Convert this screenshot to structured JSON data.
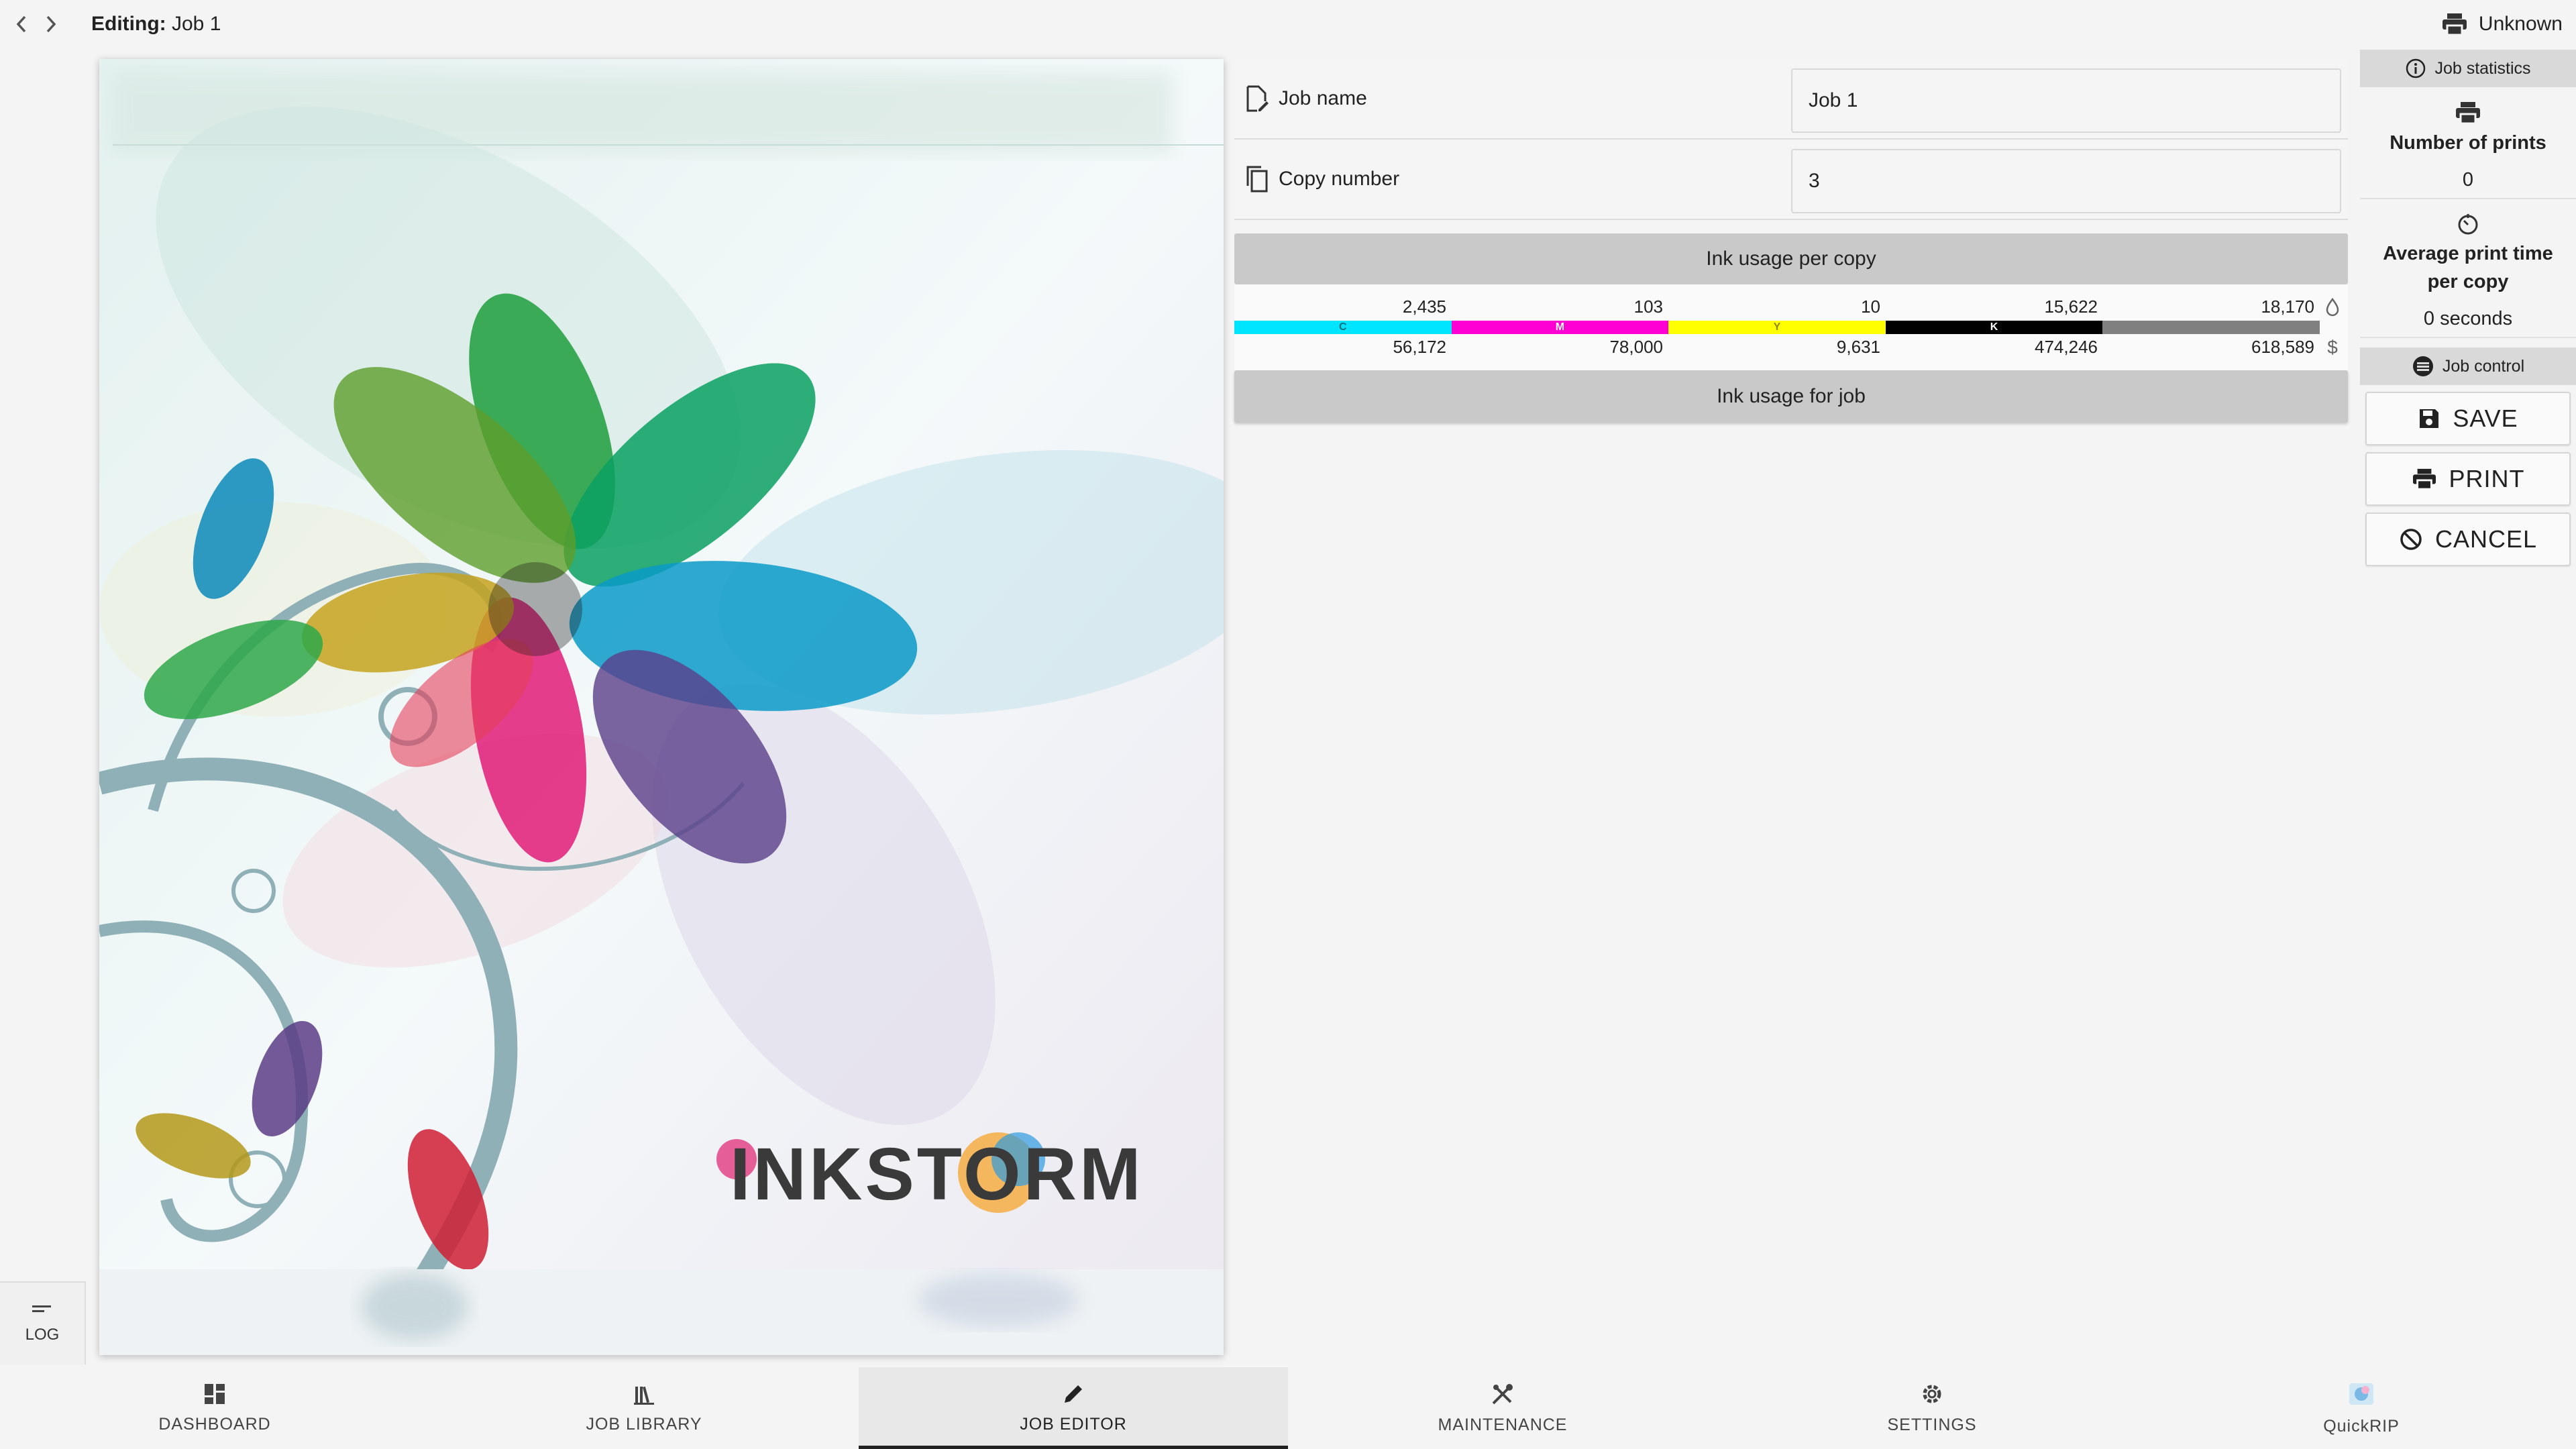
{
  "topbar": {
    "back_icon": "chevron-left-icon",
    "forward_icon": "chevron-right-icon",
    "editing_prefix": "Editing:",
    "job_title": "Job 1",
    "printer_status": "Unknown"
  },
  "log": {
    "label": "LOG"
  },
  "preview": {
    "logo_text": "INKSTORM"
  },
  "form": {
    "job_name_label": "Job name",
    "job_name_value": "Job 1",
    "copy_number_label": "Copy number",
    "copy_number_value": "3"
  },
  "ink": {
    "header": "Ink usage per copy",
    "footer": "Ink usage for job",
    "columns": [
      {
        "letter": "C",
        "color": "#00e5ff",
        "usage": "2,435",
        "cost": "56,172"
      },
      {
        "letter": "M",
        "color": "#ff00d4",
        "usage": "103",
        "cost": "78,000"
      },
      {
        "letter": "Y",
        "color": "#ffff00",
        "usage": "10",
        "cost": "9,631"
      },
      {
        "letter": "K",
        "color": "#000000",
        "usage": "15,622",
        "cost": "474,246"
      },
      {
        "letter": "",
        "color": "#808080",
        "usage": "18,170",
        "cost": "618,589"
      }
    ],
    "usage_icon": "drop-icon",
    "cost_icon": "dollar-icon"
  },
  "sidebar": {
    "stats_header": "Job statistics",
    "prints_title": "Number of prints",
    "prints_value": "0",
    "avg_title": "Average print time per copy",
    "avg_value": "0 seconds",
    "control_header": "Job control",
    "save_label": "SAVE",
    "print_label": "PRINT",
    "cancel_label": "CANCEL"
  },
  "nav": {
    "tabs": [
      {
        "label": "DASHBOARD",
        "icon": "dashboard-icon"
      },
      {
        "label": "JOB LIBRARY",
        "icon": "library-icon"
      },
      {
        "label": "JOB EDITOR",
        "icon": "pencil-icon"
      },
      {
        "label": "MAINTENANCE",
        "icon": "tools-icon"
      },
      {
        "label": "SETTINGS",
        "icon": "gear-icon"
      },
      {
        "label": "QuickRIP",
        "icon": "quickrip-icon"
      }
    ],
    "active": "JOB EDITOR"
  },
  "colors": {
    "cyan": "#00e5ff",
    "magenta": "#ff00d4",
    "yellow": "#ffff00",
    "black": "#000000",
    "gray": "#808080"
  }
}
